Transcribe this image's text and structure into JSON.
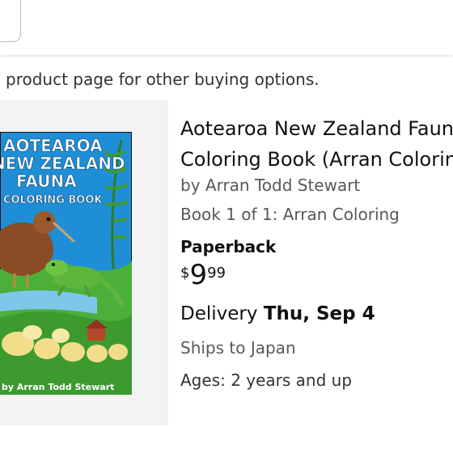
{
  "notice": "product page for other buying options.",
  "product": {
    "cover_title_lines": [
      "AOTEAROA",
      "NEW ZEALAND",
      "FAUNA",
      "COLORING BOOK"
    ],
    "cover_author": "by Arran Todd Stewart",
    "title_line1": "Aotearoa New Zealand Fauna",
    "title_line2": "Coloring Book (Arran Coloring",
    "author": "by Arran Todd Stewart",
    "series": "Book 1 of 1: Arran Coloring",
    "format": "Paperback",
    "price": {
      "symbol": "$",
      "whole": "9",
      "fraction": "99"
    },
    "delivery_prefix": "Delivery",
    "delivery_date": "Thu, Sep 4",
    "ships_to": "Ships to Japan",
    "ages": "Ages: 2 years and up"
  },
  "colors": {
    "cover_sky": "#1e8fd6",
    "cover_grass": "#4caf3a",
    "kiwi_brown": "#8a4b25",
    "lizard_green": "#5fb63d",
    "sheep": "#f2de8a",
    "text_secondary": "#565959"
  }
}
